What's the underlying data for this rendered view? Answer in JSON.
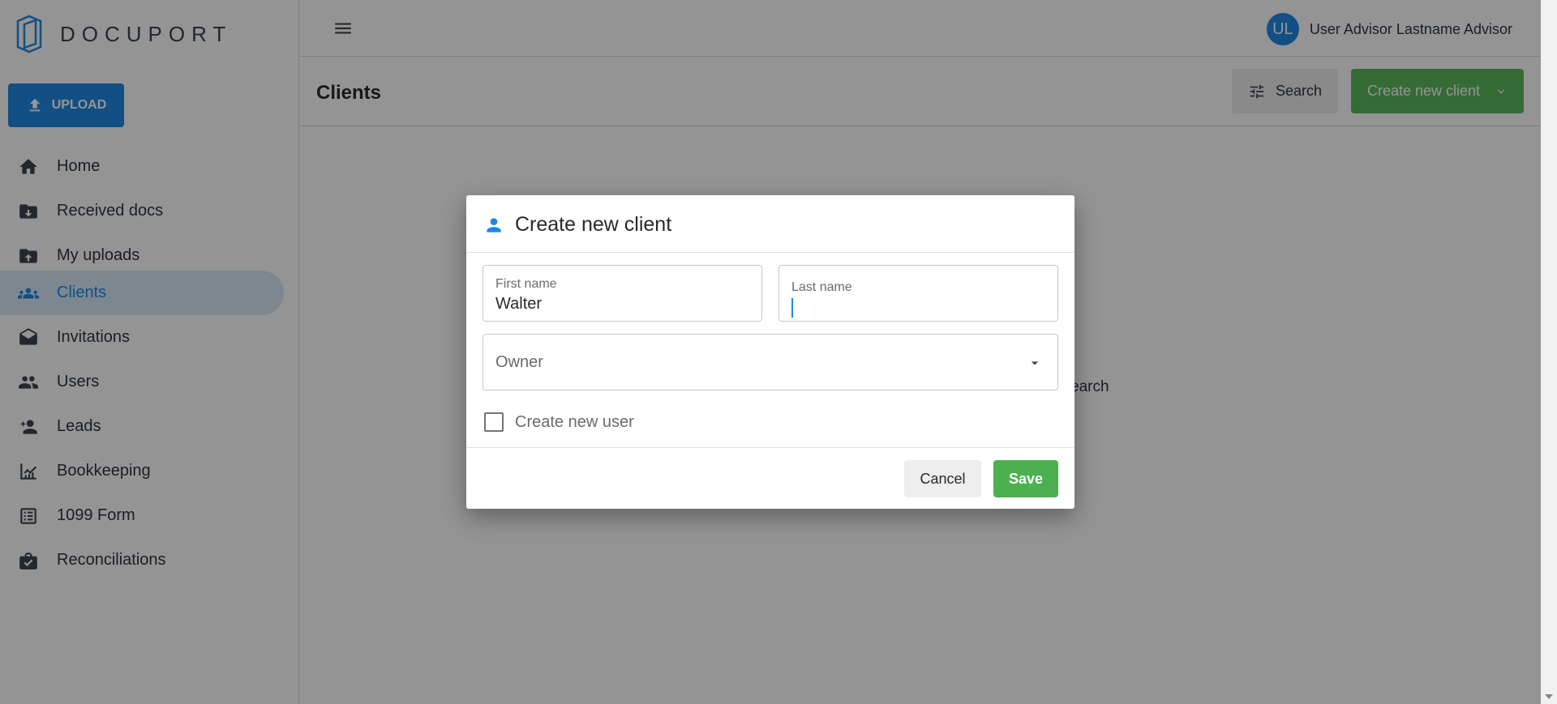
{
  "app": {
    "logo_text": "DOCUPORT",
    "accent_color": "#1e88e5",
    "success_color": "#5cb85c"
  },
  "sidebar": {
    "upload_label": "UPLOAD",
    "items": [
      {
        "label": "Home",
        "icon": "home-icon",
        "active": false
      },
      {
        "label": "Received docs",
        "icon": "received-docs-icon",
        "active": false
      },
      {
        "label": "My uploads",
        "icon": "my-uploads-icon",
        "active": false
      },
      {
        "label": "Clients",
        "icon": "clients-icon",
        "active": true
      },
      {
        "label": "Invitations",
        "icon": "invitations-icon",
        "active": false
      },
      {
        "label": "Users",
        "icon": "users-icon",
        "active": false
      },
      {
        "label": "Leads",
        "icon": "leads-icon",
        "active": false
      },
      {
        "label": "Bookkeeping",
        "icon": "bookkeeping-icon",
        "active": false
      },
      {
        "label": "1099 Form",
        "icon": "form-icon",
        "active": false
      },
      {
        "label": "Reconciliations",
        "icon": "reconciliations-icon",
        "active": false
      }
    ]
  },
  "topbar": {
    "user_initials": "UL",
    "user_name": "User Advisor Lastname Advisor"
  },
  "header": {
    "title": "Clients",
    "search_label": "Search",
    "create_label": "Create new client"
  },
  "background": {
    "partial_text": "earch"
  },
  "dialog": {
    "title": "Create new client",
    "first_name_label": "First name",
    "first_name_value": "Walter",
    "last_name_label": "Last name",
    "last_name_value": "",
    "owner_label": "Owner",
    "create_user_label": "Create new user",
    "create_user_checked": false,
    "cancel_label": "Cancel",
    "save_label": "Save"
  }
}
